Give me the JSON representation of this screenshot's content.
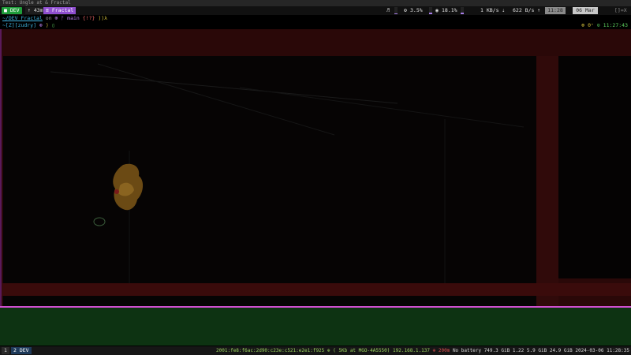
{
  "window": {
    "title": "Test: Ungle at & Fractal"
  },
  "topbar": {
    "workspace_dev": "■ DEV",
    "uptime": "⇡ 43m",
    "session_fractal": "≡ Fractal",
    "music_icon": "♬",
    "cpu_label": "3.5%",
    "cpu_level": 0.035,
    "mem_label": "18.1%",
    "mem_level": 0.181,
    "net_down": "1 KB/s ⇣",
    "net_up": "622 B/s ⇡",
    "time": "11:28",
    "date": "06 Mar",
    "layout": "[]=X"
  },
  "prompt": {
    "dir": "~/DEV_Fractal",
    "on": "on",
    "branch": "⊕ ᚠ main",
    "brace": "{",
    "bang": "!?",
    "close": "}",
    "arrow": "⟩⟩λ",
    "line2_prefix": "~[Z][zudry]",
    "line2_mid": "⊛",
    "line2_arrow": "⟩",
    "cursor": "▯",
    "right_status": "⊕ 0⁺",
    "right_time": "⊙ 11:27:43"
  },
  "bottombar": {
    "ws1": "1",
    "ws2": "2 DEV",
    "ip6": "2001:fe8:f6ac:2d90:c23e:c521:e2e1:f925",
    "net": "⊕ ( 5Kb at MGO-4A5550)",
    "ip4": "192.168.1.137",
    "warn": "⊕ 200m",
    "battery": "No battery",
    "disk": "749.3 GiB",
    "load": "1.22",
    "mem": "5.9 GiB",
    "swap": "24.9 GiB",
    "datetime": "2024-03-06 11:28:35"
  },
  "colors": {
    "accent_purple": "#8f4fcf",
    "dev_green": "#1f9d3a",
    "pane_border": "#d14fd1",
    "video_red": "#3a0b0b",
    "pane_green": "#0d3312"
  },
  "icons": [
    "music-icon",
    "cpu-icon",
    "memory-icon",
    "download-icon",
    "clock-icon"
  ]
}
